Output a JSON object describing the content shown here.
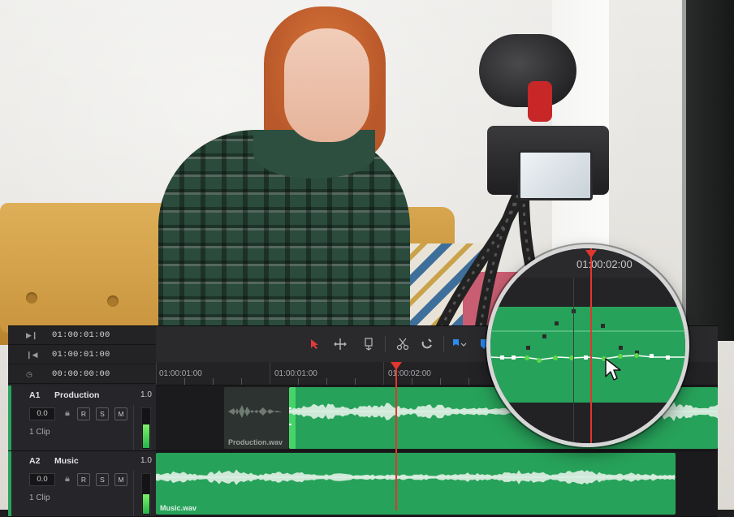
{
  "timecodes": [
    {
      "icon": "next-clip-icon",
      "value": "01:00:01:00"
    },
    {
      "icon": "previous-clip-icon",
      "value": "01:00:01:00"
    },
    {
      "icon": "clock-icon",
      "value": "00:00:00:00"
    }
  ],
  "toolbar": {
    "tools": [
      "selection-arrow-icon",
      "trim-icon",
      "blade-insert-icon",
      "razor-icon",
      "snapping-magnet-icon",
      "flag-icon",
      "marker-icon"
    ]
  },
  "ruler": {
    "labels": [
      "01:00:01:00",
      "01:00:01:00",
      "01:00:02:00"
    ]
  },
  "tracks": [
    {
      "id": "A1",
      "name": "Production",
      "volume": "1.0",
      "level": "0.0",
      "buttons": [
        "R",
        "S",
        "M"
      ],
      "clips": "1 Clip",
      "meter_level": 0.6,
      "clip_name": "Production.wav"
    },
    {
      "id": "A2",
      "name": "Music",
      "volume": "1.0",
      "level": "0.0",
      "buttons": [
        "R",
        "S",
        "M"
      ],
      "clips": "1 Clip",
      "meter_level": 0.5,
      "clip_name": "Music.wav"
    }
  ],
  "magnifier": {
    "timecode": "01:00:02:00"
  },
  "colors": {
    "clip_green": "#27a25a",
    "playhead": "#e0372f",
    "panel": "#1c1c1e"
  }
}
